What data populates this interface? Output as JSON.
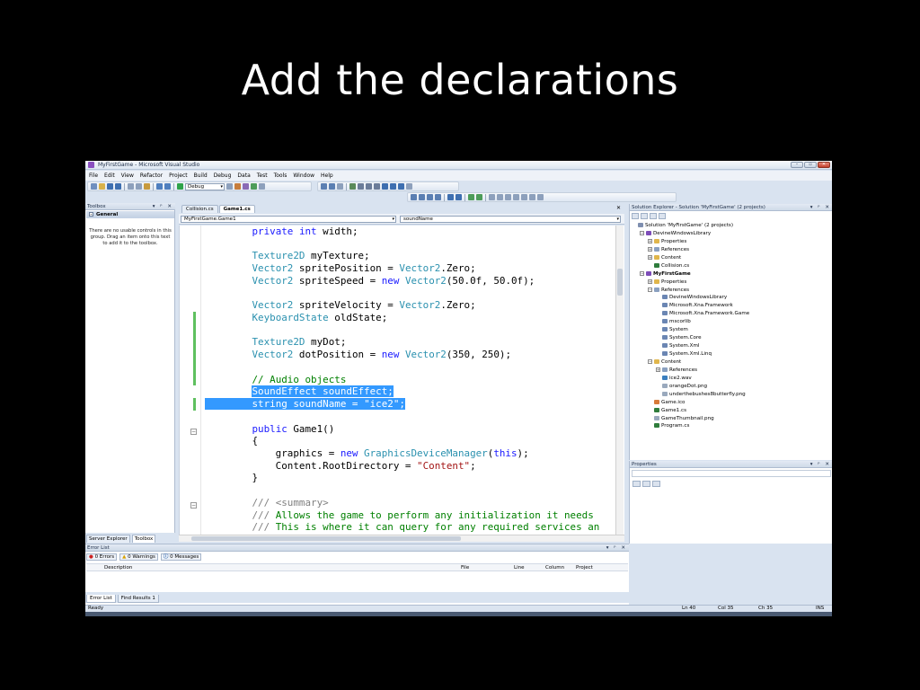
{
  "slide": {
    "title": "Add the declarations"
  },
  "window": {
    "title": "MyFirstGame - Microsoft Visual Studio",
    "buttons": [
      "–",
      "▫",
      "✕"
    ]
  },
  "menu": [
    "File",
    "Edit",
    "View",
    "Refactor",
    "Project",
    "Build",
    "Debug",
    "Data",
    "Test",
    "Tools",
    "Window",
    "Help"
  ],
  "toolbar": {
    "config": "Debug"
  },
  "toolbox": {
    "title": "Toolbox",
    "pin": "▾ ᵖ ✕",
    "group": "General",
    "empty_text": "There are no usable controls in this group. Drag an item onto this text to add it to the toolbox.",
    "tabs": [
      "Server Explorer",
      "Toolbox"
    ]
  },
  "editor": {
    "tabs": [
      "Collision.cs",
      "Game1.cs"
    ],
    "close": "✕",
    "type_combo": "MyFirstGame.Game1",
    "member_combo": "soundName"
  },
  "code_lines": [
    "        private int width;",
    "",
    "        Texture2D myTexture;",
    "        Vector2 spritePosition = Vector2.Zero;",
    "        Vector2 spriteSpeed = new Vector2(50.0f, 50.0f);",
    "",
    "        Vector2 spriteVelocity = Vector2.Zero;",
    "        KeyboardState oldState;",
    "",
    "        Texture2D myDot;",
    "        Vector2 dotPosition = new Vector2(350, 250);",
    "",
    "        // Audio objects",
    "        SoundEffect soundEffect;",
    "        string soundName = \"ice2\";",
    "",
    "        public Game1()",
    "        {",
    "            graphics = new GraphicsDeviceManager(this);",
    "            Content.RootDirectory = \"Content\";",
    "        }",
    "",
    "        /// <summary>",
    "        /// Allows the game to perform any initialization it needs",
    "        /// This is where it can query for any required services an"
  ],
  "solution_explorer": {
    "title": "Solution Explorer - Solution 'MyFirstGame' (2 projects)",
    "nodes": [
      {
        "label": "Solution 'MyFirstGame' (2 projects)",
        "icon": "solution-icon"
      },
      {
        "label": "DevineWindowsLibrary",
        "icon": "project-icon"
      },
      {
        "label": "Properties",
        "icon": "folder-icon"
      },
      {
        "label": "References",
        "icon": "references-icon"
      },
      {
        "label": "Content",
        "icon": "content-icon"
      },
      {
        "label": "Collision.cs",
        "icon": "cs-file-icon"
      },
      {
        "label": "MyFirstGame",
        "icon": "project-icon"
      },
      {
        "label": "Properties",
        "icon": "folder-icon"
      },
      {
        "label": "References",
        "icon": "references-icon"
      },
      {
        "label": "DevineWindowsLibrary",
        "icon": "reference-icon"
      },
      {
        "label": "Microsoft.Xna.Framework",
        "icon": "reference-icon"
      },
      {
        "label": "Microsoft.Xna.Framework.Game",
        "icon": "reference-icon"
      },
      {
        "label": "mscorlib",
        "icon": "reference-icon"
      },
      {
        "label": "System",
        "icon": "reference-icon"
      },
      {
        "label": "System.Core",
        "icon": "reference-icon"
      },
      {
        "label": "System.Xml",
        "icon": "reference-icon"
      },
      {
        "label": "System.Xml.Linq",
        "icon": "reference-icon"
      },
      {
        "label": "Content",
        "icon": "content-icon"
      },
      {
        "label": "References",
        "icon": "references-icon"
      },
      {
        "label": "ice2.wav",
        "icon": "audio-file-icon"
      },
      {
        "label": "orangeDot.png",
        "icon": "image-file-icon"
      },
      {
        "label": "underthebushes8butterfly.png",
        "icon": "image-file-icon"
      },
      {
        "label": "Game.ico",
        "icon": "ico-file-icon"
      },
      {
        "label": "Game1.cs",
        "icon": "cs-file-icon"
      },
      {
        "label": "GameThumbnail.png",
        "icon": "image-file-icon"
      },
      {
        "label": "Program.cs",
        "icon": "cs-file-icon"
      }
    ]
  },
  "properties": {
    "title": "Properties"
  },
  "error_list": {
    "title": "Error List",
    "filters": [
      "0 Errors",
      "0 Warnings",
      "0 Messages"
    ],
    "columns": [
      "Description",
      "File",
      "Line",
      "Column",
      "Project"
    ],
    "tabs": [
      "Error List",
      "Find Results 1"
    ]
  },
  "status": {
    "ready": "Ready",
    "ln": "Ln 40",
    "col": "Col 35",
    "ch": "Ch 35",
    "ins": "INS"
  },
  "colors": {
    "keyword": "#1a1aff",
    "type": "#2b91af",
    "string": "#a31515",
    "comment": "#008000",
    "selection": "#3399ff"
  }
}
